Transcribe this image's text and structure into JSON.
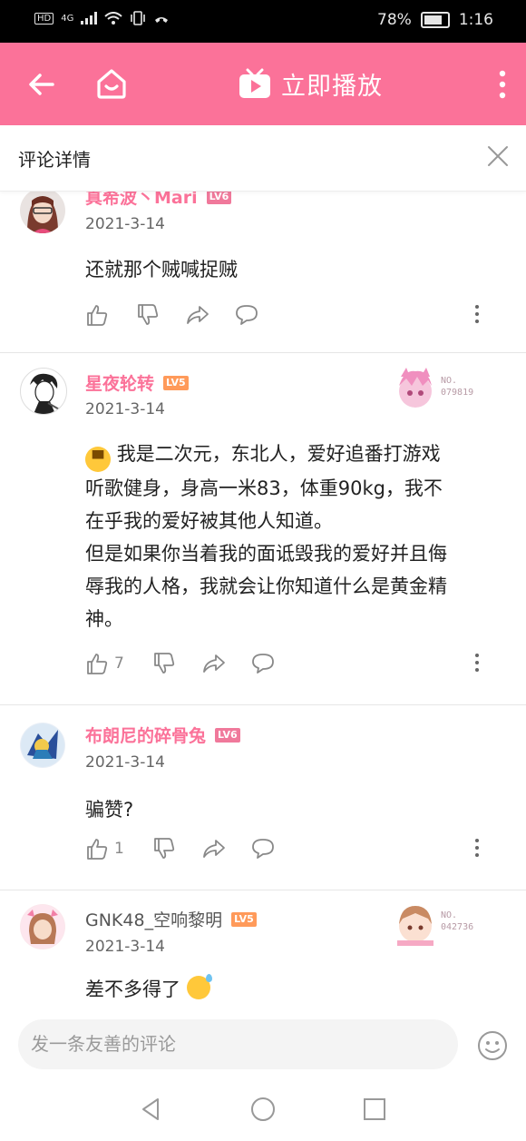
{
  "status": {
    "left_icons": [
      "HD",
      "4G",
      "signal-icon",
      "wifi-icon",
      "vibrate-icon",
      "call-icon"
    ],
    "hd": "HD",
    "net": "4G",
    "battery": "78%",
    "time": "1:16"
  },
  "appbar": {
    "title": "立即播放",
    "accent": "#fb7299"
  },
  "sheet": {
    "title": "评论详情"
  },
  "comments": [
    {
      "user": "真希波丶Mari",
      "level": "LV6",
      "level_color": "#f0799b",
      "date": "2021-3-14",
      "text": "还就那个贼喊捉贼",
      "likes": "",
      "badge_no": ""
    },
    {
      "user": "星夜轮转",
      "level": "LV5",
      "level_color": "#ff9a5a",
      "date": "2021-3-14",
      "text_lines": [
        "我是二次元，东北人，爱好追番打游戏",
        "听歌健身，身高一米83，体重90kg，我不",
        "在乎我的爱好被其他人知道。",
        "但是如果你当着我的面诋毁我的爱好并且侮",
        "辱我的人格，我就会让你知道什么是黄金精",
        "神。"
      ],
      "likes": "7",
      "badge_label": "NO.",
      "badge_no": "079819"
    },
    {
      "user": "布朗尼的碎骨兔",
      "level": "LV6",
      "level_color": "#f0799b",
      "date": "2021-3-14",
      "text": "骗赞?",
      "likes": "1",
      "badge_no": ""
    },
    {
      "user": "GNK48_空响黎明",
      "level": "LV5",
      "level_color": "#ff9a5a",
      "date": "2021-3-14",
      "text": "差不多得了",
      "likes": "",
      "badge_label": "NO.",
      "badge_no": "042736"
    }
  ],
  "composer": {
    "placeholder": "发一条友善的评论"
  }
}
